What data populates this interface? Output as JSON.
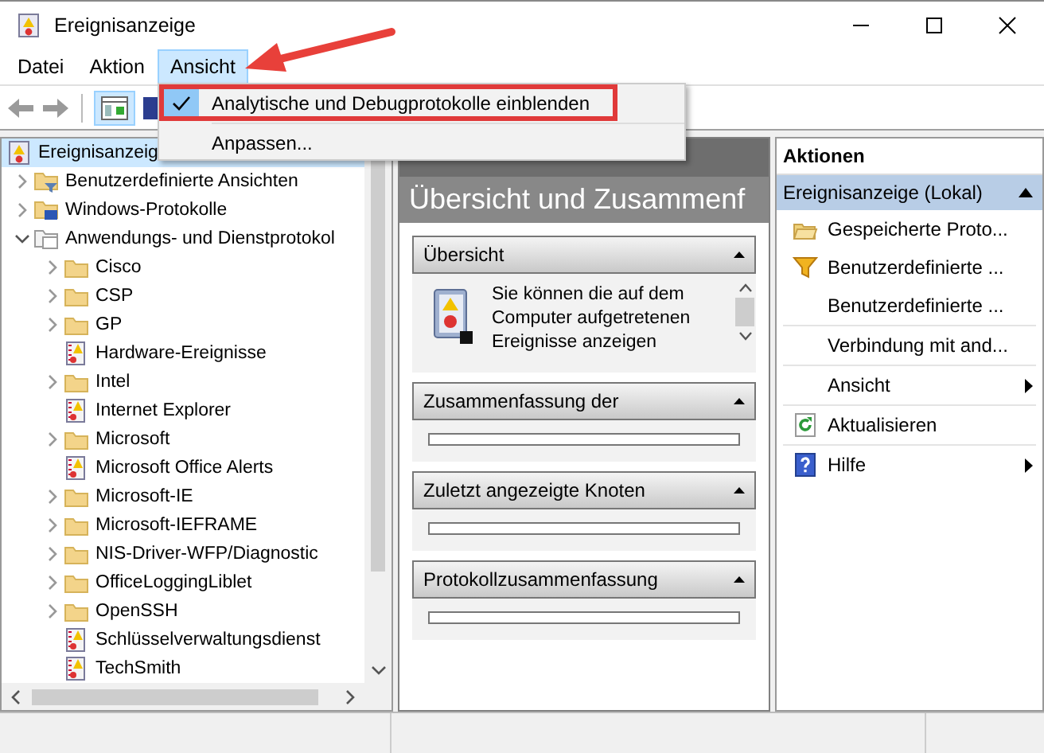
{
  "window": {
    "title": "Ereignisanzeige"
  },
  "menu_bar": [
    {
      "label": "Datei",
      "selected": false
    },
    {
      "label": "Aktion",
      "selected": false
    },
    {
      "label": "Ansicht",
      "selected": true
    }
  ],
  "dropdown_menu": [
    {
      "label": "Analytische und Debugprotokolle einblenden",
      "checked": true
    },
    {
      "label": "Anpassen...",
      "checked": false
    }
  ],
  "tree": [
    {
      "label": "Ereignisanzeig",
      "kind": "root",
      "selected": true,
      "children": [
        {
          "label": "Benutzerdefinierte Ansichten",
          "kind": "custom-views",
          "expanded": false,
          "selected": false
        },
        {
          "label": "Windows-Protokolle",
          "kind": "windows-logs",
          "expanded": false,
          "selected": false
        },
        {
          "label": "Anwendungs- und Dienstprotokol",
          "kind": "folder",
          "expanded": true,
          "selected": false,
          "children": [
            {
              "label": "Cisco",
              "kind": "folder",
              "expanded": false,
              "selected": false
            },
            {
              "label": "CSP",
              "kind": "folder",
              "expanded": false,
              "selected": false
            },
            {
              "label": "GP",
              "kind": "folder",
              "expanded": false,
              "selected": false
            },
            {
              "label": "Hardware-Ereignisse",
              "kind": "log",
              "selected": false
            },
            {
              "label": "Intel",
              "kind": "folder",
              "expanded": false,
              "selected": false
            },
            {
              "label": "Internet Explorer",
              "kind": "log",
              "selected": false
            },
            {
              "label": "Microsoft",
              "kind": "folder",
              "expanded": false,
              "selected": false
            },
            {
              "label": "Microsoft Office Alerts",
              "kind": "log",
              "selected": false
            },
            {
              "label": "Microsoft-IE",
              "kind": "folder",
              "expanded": false,
              "selected": false
            },
            {
              "label": "Microsoft-IEFRAME",
              "kind": "folder",
              "expanded": false,
              "selected": false
            },
            {
              "label": "NIS-Driver-WFP/Diagnostic",
              "kind": "folder",
              "expanded": false,
              "selected": false
            },
            {
              "label": "OfficeLoggingLiblet",
              "kind": "folder",
              "expanded": false,
              "selected": false
            },
            {
              "label": "OpenSSH",
              "kind": "folder",
              "expanded": false,
              "selected": false
            },
            {
              "label": "Schlüsselverwaltungsdienst",
              "kind": "log",
              "selected": false
            },
            {
              "label": "TechSmith",
              "kind": "log",
              "selected": false
            }
          ]
        }
      ]
    }
  ],
  "overview": {
    "title": "Übersicht und Zusammenf",
    "panels": [
      {
        "title": "Übersicht",
        "kind": "text",
        "text": "Sie können die auf dem Computer aufgetretenen Ereignisse anzeigen"
      },
      {
        "title": "Zusammenfassung der",
        "kind": "table"
      },
      {
        "title": "Zuletzt angezeigte Knoten",
        "kind": "table"
      },
      {
        "title": "Protokollzusammenfassung",
        "kind": "table"
      }
    ]
  },
  "actions": {
    "title": "Aktionen",
    "section": "Ereignisanzeige (Lokal)",
    "items": [
      {
        "label": "Gespeicherte Proto...",
        "kind": "open-log",
        "submenu": false,
        "separator_before": false
      },
      {
        "label": "Benutzerdefinierte ...",
        "kind": "filter",
        "submenu": false,
        "separator_before": false
      },
      {
        "label": "Benutzerdefinierte ...",
        "kind": "plain",
        "submenu": false,
        "separator_before": false
      },
      {
        "label": "Verbindung mit and...",
        "kind": "plain",
        "submenu": false,
        "separator_before": true
      },
      {
        "label": "Ansicht",
        "kind": "plain",
        "submenu": true,
        "separator_before": true
      },
      {
        "label": "Aktualisieren",
        "kind": "refresh",
        "submenu": false,
        "separator_before": true
      },
      {
        "label": "Hilfe",
        "kind": "help",
        "submenu": true,
        "separator_before": true
      }
    ]
  }
}
